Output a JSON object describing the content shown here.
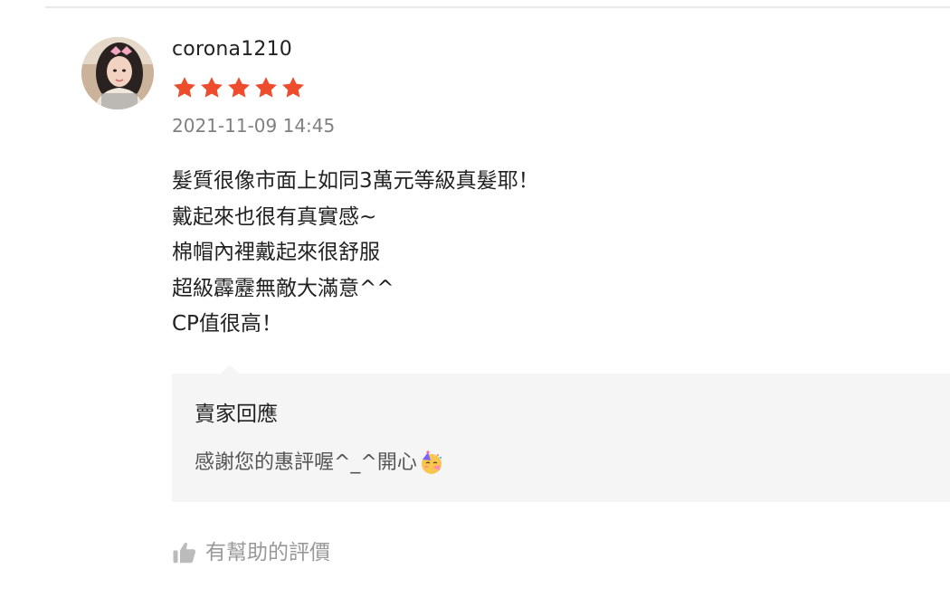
{
  "review": {
    "username": "corona1210",
    "rating": 5,
    "rating_max": 5,
    "timestamp": "2021-11-09 14:45",
    "lines": [
      "髮質很像市面上如同3萬元等級真髮耶！",
      "戴起來也很有真實感~",
      "棉帽內裡戴起來很舒服",
      "超級霹靂無敵大滿意^^",
      "CP值很高！"
    ]
  },
  "seller_reply": {
    "title": "賣家回應",
    "text": "感謝您的惠評喔^_^開心",
    "emoji": "partying-face-icon"
  },
  "helpful": {
    "label": "有幫助的評價",
    "icon": "thumbs-up-icon"
  },
  "colors": {
    "star": "#ee4d2d",
    "reply_background": "#f5f5f5",
    "muted_text": "#999999",
    "timestamp_text": "#808080"
  }
}
